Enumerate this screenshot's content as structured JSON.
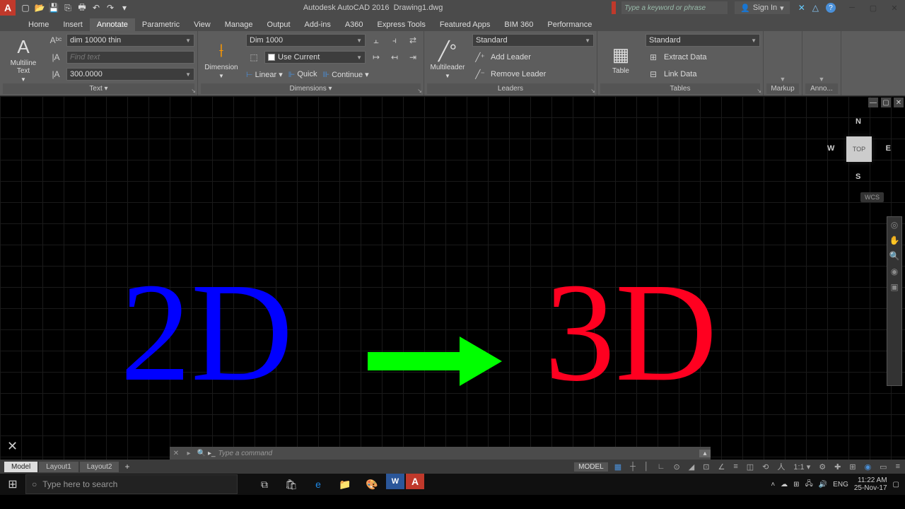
{
  "titlebar": {
    "app": "Autodesk AutoCAD 2016",
    "file": "Drawing1.dwg",
    "search_placeholder": "Type a keyword or phrase",
    "signin": "Sign In"
  },
  "tabs": [
    "Home",
    "Insert",
    "Annotate",
    "Parametric",
    "View",
    "Manage",
    "Output",
    "Add-ins",
    "A360",
    "Express Tools",
    "Featured Apps",
    "BIM 360",
    "Performance"
  ],
  "active_tab": "Annotate",
  "text_panel": {
    "title": "Text ▾",
    "big": "Multiline\nText",
    "style": "dim 10000 thin",
    "find_placeholder": "Find text",
    "height": "300.0000"
  },
  "dim_panel": {
    "title": "Dimensions ▾",
    "big": "Dimension",
    "style": "Dim 1000",
    "use_current": "Use Current",
    "btn1": "Linear ▾",
    "btn2": "Quick",
    "btn3": "Continue ▾"
  },
  "leader_panel": {
    "title": "Leaders",
    "big": "Multileader",
    "style": "Standard",
    "add": "Add Leader",
    "remove": "Remove Leader"
  },
  "table_panel": {
    "title": "Tables",
    "big": "Table",
    "style": "Standard",
    "extract": "Extract Data",
    "link": "Link Data"
  },
  "markup_panel": {
    "title": "Markup"
  },
  "anno_panel": {
    "title": "Anno..."
  },
  "viewcube": {
    "top": "TOP",
    "n": "N",
    "s": "S",
    "e": "E",
    "w": "W",
    "wcs": "WCS"
  },
  "canvas": {
    "text2d": "2D",
    "text3d": "3D"
  },
  "cmd_placeholder": "Type a command",
  "model_tabs": [
    "Model",
    "Layout1",
    "Layout2"
  ],
  "status": {
    "model": "MODEL",
    "scale": "1:1"
  },
  "taskbar": {
    "search": "Type here to search",
    "time": "11:22 AM",
    "date": "25-Nov-17",
    "lang": "ENG"
  }
}
